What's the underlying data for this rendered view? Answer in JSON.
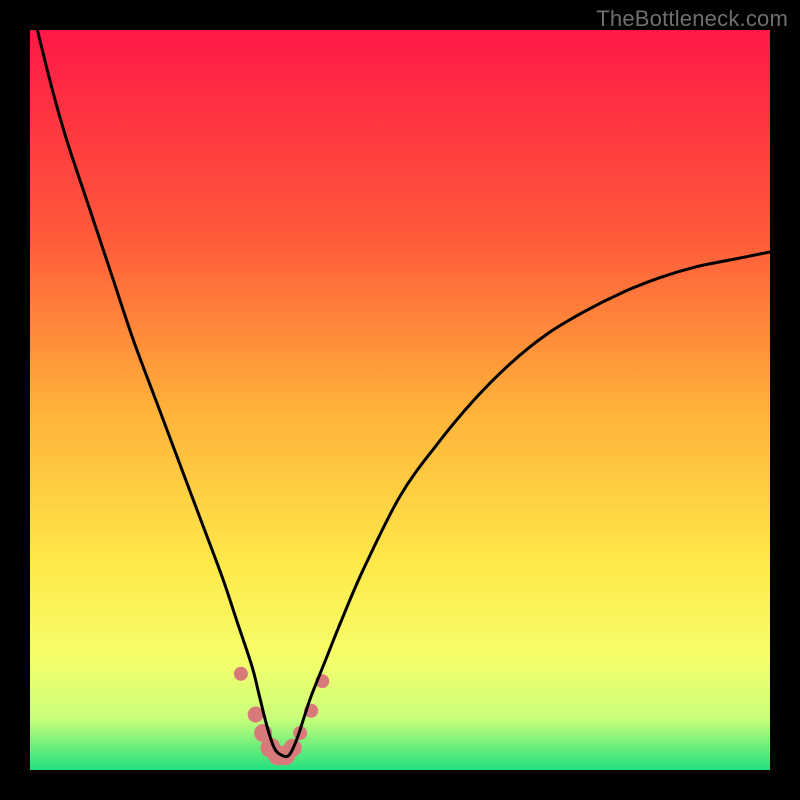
{
  "watermark": "TheBottleneck.com",
  "colors": {
    "bg_black": "#000000",
    "curve_black": "#000000",
    "marker_pink": "#d97a7a",
    "grad_top": "#ff1846",
    "grad_mid1": "#ff5a3a",
    "grad_mid2": "#ffb43a",
    "grad_mid3": "#ffe84a",
    "grad_mid4": "#f6ff6a",
    "grad_mid5": "#c9ff7a",
    "grad_bottom": "#23e07d"
  },
  "chart_data": {
    "type": "line",
    "title": "",
    "xlabel": "",
    "ylabel": "",
    "xlim": [
      0,
      100
    ],
    "ylim": [
      0,
      100
    ],
    "min_x": 33,
    "series": [
      {
        "name": "bottleneck-curve",
        "x": [
          1,
          3,
          5,
          8,
          11,
          14,
          17,
          20,
          23,
          26,
          28,
          30,
          31,
          32,
          33,
          34,
          35,
          36,
          37,
          38,
          40,
          42,
          45,
          50,
          55,
          60,
          65,
          70,
          75,
          80,
          85,
          90,
          95,
          100
        ],
        "y": [
          100,
          92,
          85,
          76,
          67,
          58,
          50,
          42,
          34,
          26,
          20,
          14,
          10,
          6,
          3,
          2,
          2,
          4,
          7,
          10,
          15,
          20,
          27,
          37,
          44,
          50,
          55,
          59,
          62,
          64.5,
          66.5,
          68,
          69,
          70
        ]
      }
    ],
    "markers": {
      "name": "highlight-dots",
      "x": [
        28.5,
        30.5,
        31.5,
        32.5,
        33.5,
        34.5,
        35.5,
        36.5,
        38,
        39.5
      ],
      "y": [
        13,
        7.5,
        5,
        3,
        2,
        2,
        3,
        5,
        8,
        12
      ],
      "r": [
        7,
        8,
        9,
        10,
        10,
        10,
        9,
        7,
        7,
        7
      ]
    }
  }
}
